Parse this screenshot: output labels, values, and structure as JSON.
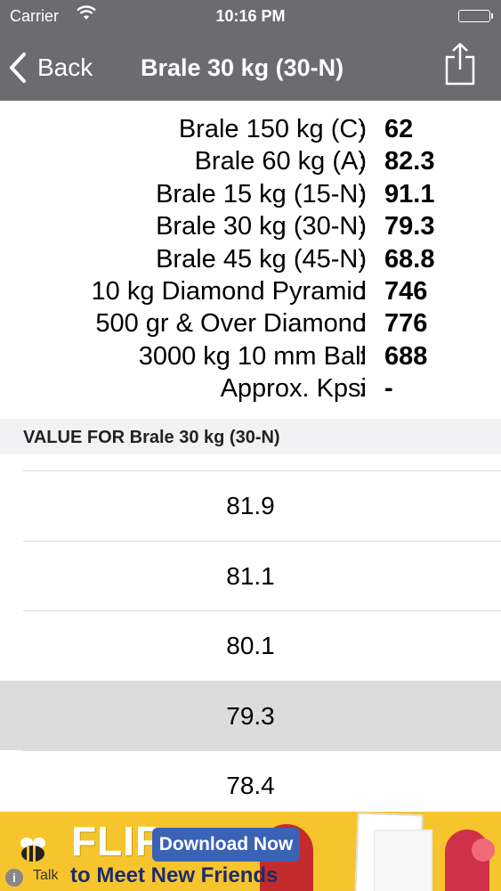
{
  "status": {
    "carrier": "Carrier",
    "time": "10:16 PM"
  },
  "nav": {
    "back_label": "Back",
    "title": "Brale 30 kg (30-N)"
  },
  "results": [
    {
      "label": "Brale 150 kg (C)",
      "colon": ":",
      "value": "62"
    },
    {
      "label": "Brale 60 kg (A)",
      "colon": ":",
      "value": "82.3"
    },
    {
      "label": "Brale 15 kg (15-N)",
      "colon": ":",
      "value": "91.1"
    },
    {
      "label": "Brale 30 kg (30-N)",
      "colon": ":",
      "value": "79.3"
    },
    {
      "label": "Brale 45 kg (45-N)",
      "colon": ":",
      "value": "68.8"
    },
    {
      "label": "10 kg Diamond Pyramid",
      "colon": ":",
      "value": "746"
    },
    {
      "label": "500 gr & Over Diamond",
      "colon": ":",
      "value": "776"
    },
    {
      "label": "3000 kg 10 mm Ball",
      "colon": ":",
      "value": "688"
    },
    {
      "label": "Approx. Kpsi",
      "colon": ":",
      "value": "-"
    }
  ],
  "section_header": "VALUE FOR Brale 30 kg (30-N)",
  "picker": {
    "options": [
      "81.9",
      "81.1",
      "80.1",
      "79.3",
      "78.4"
    ],
    "selected": "79.3"
  },
  "ad": {
    "brand": "FLIP",
    "button": "Download Now",
    "tagline": "to Meet New Friends",
    "sponsor": "Talk",
    "info": "i"
  },
  "colors": {
    "nav_background": "#6b6b70",
    "section_background": "#f2f2f4",
    "selected_row": "#dcdcdc",
    "ad_background": "#f6c52e",
    "ad_button": "#3a62b5"
  }
}
